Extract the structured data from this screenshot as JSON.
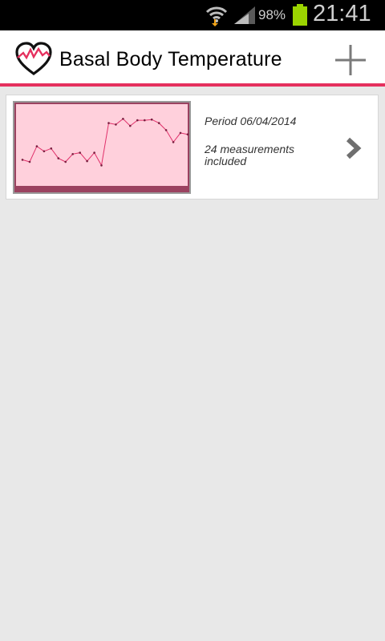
{
  "status_bar": {
    "battery_percent": "98%",
    "time": "21:41",
    "icons": [
      "wifi-icon",
      "signal-icon",
      "battery-icon"
    ],
    "battery_color": "#9bd400"
  },
  "action_bar": {
    "title": "Basal Body Temperature",
    "app_icon": "heart-chart-icon",
    "add_icon": "plus-icon",
    "accent_color": "#e5305e"
  },
  "periods": [
    {
      "period_label": "Period 06/04/2014",
      "measurements_label": "24 measurements included",
      "measurement_count": 24,
      "chart_data": {
        "type": "line",
        "values": [
          0.28,
          0.25,
          0.47,
          0.4,
          0.44,
          0.3,
          0.25,
          0.36,
          0.38,
          0.26,
          0.38,
          0.2,
          0.8,
          0.78,
          0.86,
          0.76,
          0.84,
          0.84,
          0.85,
          0.8,
          0.7,
          0.53,
          0.66,
          0.64
        ],
        "ylim": [
          0,
          1
        ],
        "line_color": "#e0306a",
        "background_color": "#ffd0dc"
      }
    }
  ]
}
